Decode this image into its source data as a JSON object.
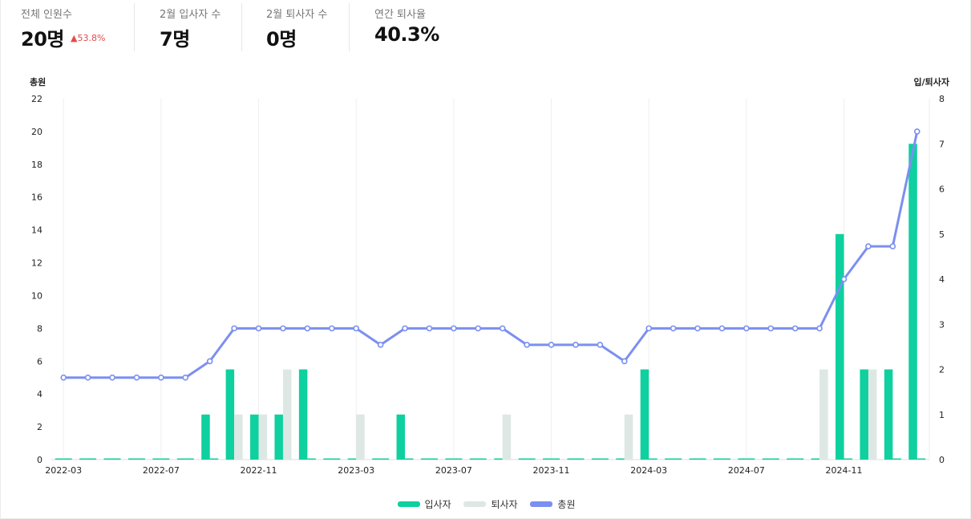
{
  "stats": [
    {
      "label": "전체 인원수",
      "value": "20명",
      "change": "▲53.8%"
    },
    {
      "label": "2월 입사자 수",
      "value": "7명"
    },
    {
      "label": "2월 퇴사자 수",
      "value": "0명"
    },
    {
      "label": "연간 퇴사율",
      "value": "40.3%"
    }
  ],
  "colors": {
    "hires": "#0fd09f",
    "exits": "#dde8e4",
    "total": "#7b8ff0",
    "change": "#e34b4b"
  },
  "chart_data": {
    "type": "bar",
    "left_axis_title": "총원",
    "right_axis_title": "입/퇴사자",
    "left_ylim": [
      0,
      22
    ],
    "left_ticks": [
      0,
      2,
      4,
      6,
      8,
      10,
      12,
      14,
      16,
      18,
      20,
      22
    ],
    "right_ylim": [
      0,
      8
    ],
    "right_ticks": [
      0,
      1,
      2,
      3,
      4,
      5,
      6,
      7,
      8
    ],
    "categories": [
      "2022-03",
      "2022-04",
      "2022-05",
      "2022-06",
      "2022-07",
      "2022-08",
      "2022-09",
      "2022-10",
      "2022-11",
      "2022-12",
      "2023-01",
      "2023-02",
      "2023-03",
      "2023-04",
      "2023-05",
      "2023-06",
      "2023-07",
      "2023-08",
      "2023-09",
      "2023-10",
      "2023-11",
      "2023-12",
      "2024-01",
      "2024-02",
      "2024-03",
      "2024-04",
      "2024-05",
      "2024-06",
      "2024-07",
      "2024-08",
      "2024-09",
      "2024-10",
      "2024-11",
      "2024-12",
      "2025-01",
      "2025-02"
    ],
    "tick_labels": [
      "2022-03",
      "2022-07",
      "2022-11",
      "2023-03",
      "2023-07",
      "2023-11",
      "2024-03",
      "2024-07",
      "2024-11"
    ],
    "grid": true,
    "legend_position": "bottom-center",
    "series": [
      {
        "name": "입사자",
        "axis": "right",
        "kind": "bar",
        "values": [
          0,
          0,
          0,
          0,
          0,
          0,
          1,
          2,
          1,
          1,
          2,
          0,
          0,
          0,
          1,
          0,
          0,
          0,
          0,
          0,
          0,
          0,
          0,
          0,
          2,
          0,
          0,
          0,
          0,
          0,
          0,
          0,
          5,
          2,
          2,
          7
        ]
      },
      {
        "name": "퇴사자",
        "axis": "right",
        "kind": "bar",
        "values": [
          0,
          0,
          0,
          0,
          0,
          0,
          0,
          1,
          1,
          2,
          0,
          0,
          1,
          0,
          0,
          0,
          0,
          0,
          1,
          0,
          0,
          0,
          0,
          1,
          0,
          0,
          0,
          0,
          0,
          0,
          0,
          2,
          0,
          2,
          0,
          0
        ]
      },
      {
        "name": "총원",
        "axis": "left",
        "kind": "line",
        "values": [
          5,
          5,
          5,
          5,
          5,
          5,
          6,
          8,
          8,
          8,
          8,
          8,
          8,
          7,
          8,
          8,
          8,
          8,
          8,
          7,
          7,
          7,
          7,
          6,
          8,
          8,
          8,
          8,
          8,
          8,
          8,
          8,
          11,
          13,
          13,
          20
        ]
      }
    ]
  }
}
